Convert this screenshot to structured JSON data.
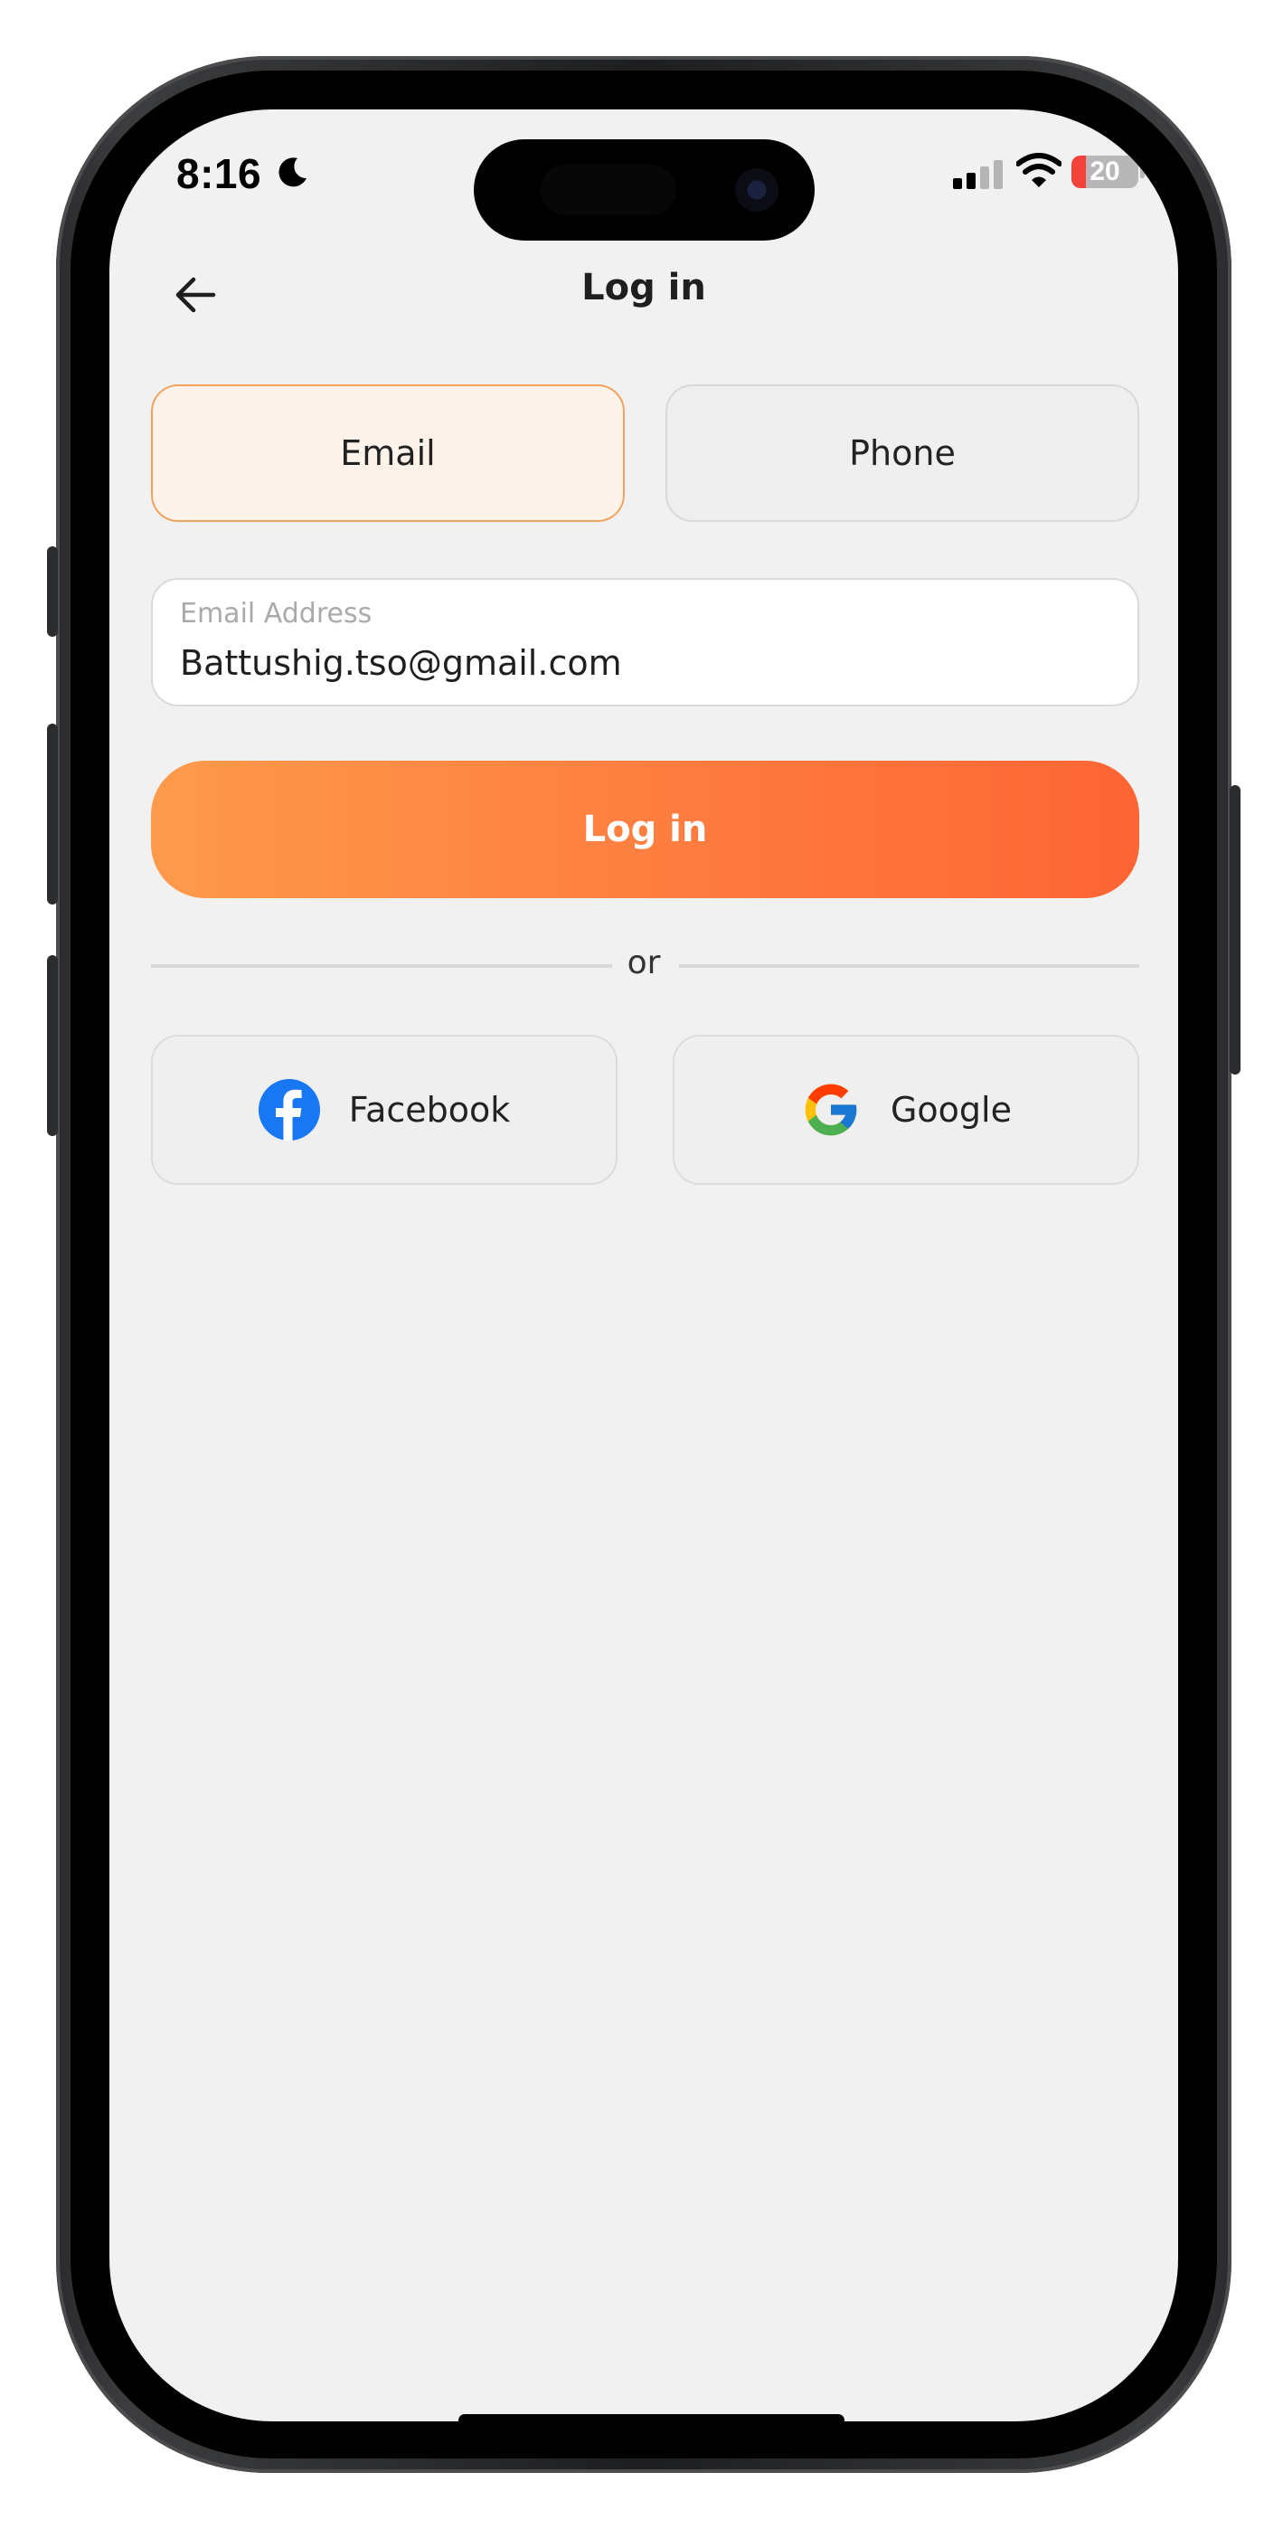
{
  "status_bar": {
    "time": "8:16",
    "battery_level": "20"
  },
  "header": {
    "title": "Log in"
  },
  "tabs": [
    {
      "label": "Email",
      "selected": true
    },
    {
      "label": "Phone",
      "selected": false
    }
  ],
  "email_field": {
    "label": "Email Address",
    "value": "Battushig.tso@gmail.com"
  },
  "login_button": {
    "label": "Log in"
  },
  "divider": {
    "text": "or"
  },
  "social": [
    {
      "label": "Facebook",
      "icon": "facebook-icon"
    },
    {
      "label": "Google",
      "icon": "google-icon"
    }
  ],
  "colors": {
    "accent": "#fe7c3f",
    "accent_start": "#fe9a4b",
    "accent_end": "#fd6534",
    "selected_tab_bg": "#fdf3eb",
    "selected_tab_border": "#f2a35e",
    "screen_bg": "#f1f1f1",
    "facebook_blue": "#1877f2",
    "battery_low": "#f2423a"
  }
}
